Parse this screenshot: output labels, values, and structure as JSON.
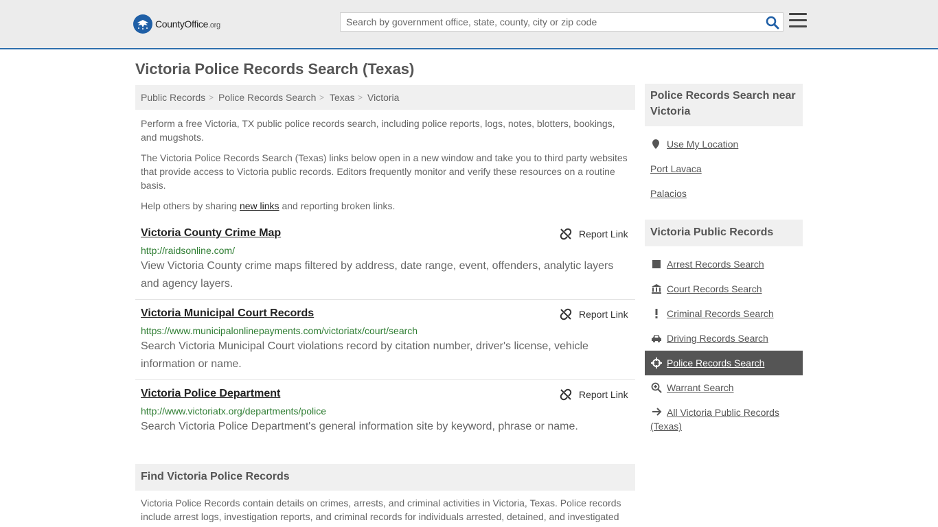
{
  "header": {
    "logo_text_main": "CountyOffice",
    "logo_text_suffix": ".org",
    "search_placeholder": "Search by government office, state, county, city or zip code"
  },
  "page": {
    "title": "Victoria Police Records Search (Texas)"
  },
  "breadcrumb": [
    "Public Records",
    "Police Records Search",
    "Texas",
    "Victoria"
  ],
  "breadcrumb_separator": ">",
  "intro": {
    "p1": "Perform a free Victoria, TX public police records search, including police reports, logs, notes, blotters, bookings, and mugshots.",
    "p2": "The Victoria Police Records Search (Texas) links below open in a new window and take you to third party websites that provide access to Victoria public records. Editors frequently monitor and verify these resources on a routine basis.",
    "p3_before": "Help others by sharing ",
    "p3_link": "new links",
    "p3_after": " and reporting broken links."
  },
  "report_label": "Report Link",
  "results": [
    {
      "title": "Victoria County Crime Map",
      "url": "http://raidsonline.com/",
      "desc": "View Victoria County crime maps filtered by address, date range, event, offenders, analytic layers and agency layers."
    },
    {
      "title": "Victoria Municipal Court Records",
      "url": "https://www.municipalonlinepayments.com/victoriatx/court/search",
      "desc": "Search Victoria Municipal Court violations record by citation number, driver's license, vehicle information or name."
    },
    {
      "title": "Victoria Police Department",
      "url": "http://www.victoriatx.org/departments/police",
      "desc": "Search Victoria Police Department's general information site by keyword, phrase or name."
    }
  ],
  "find": {
    "title": "Find Victoria Police Records",
    "desc": "Victoria Police Records contain details on crimes, arrests, and criminal activities in Victoria, Texas. Police records include arrest logs, investigation reports, and criminal records for individuals arrested, detained, and investigated"
  },
  "sidebar": {
    "nearby_title": "Police Records Search near Victoria",
    "nearby_links": [
      "Use My Location",
      "Port Lavaca",
      "Palacios"
    ],
    "records_title": "Victoria Public Records",
    "records_items": [
      {
        "label": "Arrest Records Search",
        "icon": "square-icon"
      },
      {
        "label": "Court Records Search",
        "icon": "courthouse-icon"
      },
      {
        "label": "Criminal Records Search",
        "icon": "exclamation-icon"
      },
      {
        "label": "Driving Records Search",
        "icon": "car-icon"
      },
      {
        "label": "Police Records Search",
        "icon": "crosshair-icon",
        "active": true
      },
      {
        "label": "Warrant Search",
        "icon": "magnifier-plus-icon"
      },
      {
        "label": "All Victoria Public Records (Texas)",
        "icon": "arrow-right-icon"
      }
    ]
  },
  "colors": {
    "brand_blue": "#1f5fa6",
    "link_green": "#2e7d32",
    "active_bg": "#555555"
  }
}
